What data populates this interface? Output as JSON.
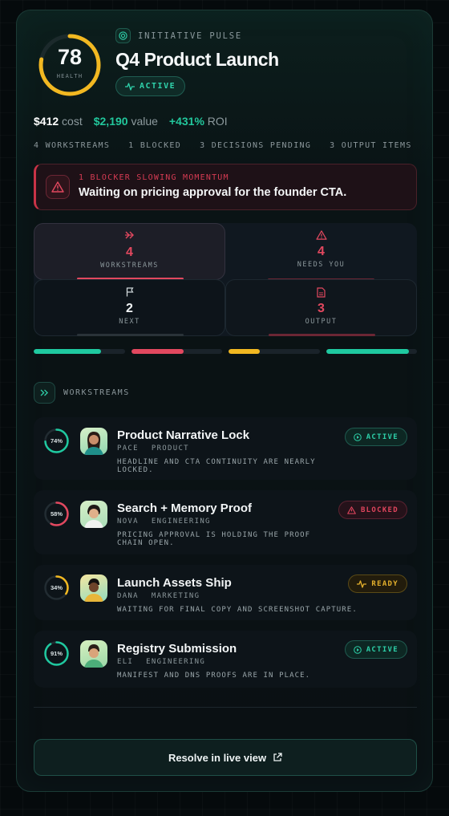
{
  "header": {
    "health_score": "78",
    "health_label": "HEALTH",
    "health_value": 0.78,
    "eyebrow": "INITIATIVE PULSE",
    "title": "Q4 Product Launch",
    "status": "ACTIVE"
  },
  "metrics": {
    "cost_value": "$412",
    "cost_label": "cost",
    "value_value": "$2,190",
    "value_label": "value",
    "roi_value": "+431%",
    "roi_label": "ROI"
  },
  "counts": [
    "4 WORKSTREAMS",
    "1 BLOCKED",
    "3 DECISIONS PENDING",
    "3 OUTPUT ITEMS"
  ],
  "alert": {
    "kicker": "1 BLOCKER SLOWING MOMENTUM",
    "message": "Waiting on pricing approval for the founder CTA."
  },
  "stats": [
    {
      "value": "4",
      "label": "WORKSTREAMS",
      "icon": "double-chevron-right-icon",
      "color": "#e2485f"
    },
    {
      "value": "4",
      "label": "NEEDS YOU",
      "icon": "warning-icon",
      "color": "#e2485f"
    },
    {
      "value": "2",
      "label": "NEXT",
      "icon": "flag-icon",
      "color": "#f2f5f6"
    },
    {
      "value": "3",
      "label": "OUTPUT",
      "icon": "document-icon",
      "color": "#e2485f"
    }
  ],
  "progress_segments": [
    {
      "fill": 0.74,
      "color": "#1fc9a0"
    },
    {
      "fill": 0.58,
      "color": "#e2485f"
    },
    {
      "fill": 0.34,
      "color": "#f2b821"
    },
    {
      "fill": 0.91,
      "color": "#1fc9a0"
    }
  ],
  "section_title": "WORKSTREAMS",
  "workstreams": [
    {
      "pct": "74%",
      "progress": 0.74,
      "ring_color": "#1fc9a0",
      "name": "Product Narrative Lock",
      "owner": "PACE",
      "team": "PRODUCT",
      "desc": "HEADLINE AND CTA CONTINUITY ARE NEARLY LOCKED.",
      "status": "ACTIVE",
      "status_icon": "play-circle-icon"
    },
    {
      "pct": "58%",
      "progress": 0.58,
      "ring_color": "#e2485f",
      "name": "Search + Memory Proof",
      "owner": "NOVA",
      "team": "ENGINEERING",
      "desc": "PRICING APPROVAL IS HOLDING THE PROOF CHAIN OPEN.",
      "status": "BLOCKED",
      "status_icon": "warning-icon"
    },
    {
      "pct": "34%",
      "progress": 0.34,
      "ring_color": "#f2b821",
      "name": "Launch Assets Ship",
      "owner": "DANA",
      "team": "MARKETING",
      "desc": "WAITING FOR FINAL COPY AND SCREENSHOT CAPTURE.",
      "status": "READY",
      "status_icon": "pulse-icon"
    },
    {
      "pct": "91%",
      "progress": 0.91,
      "ring_color": "#1fc9a0",
      "name": "Registry Submission",
      "owner": "ELI",
      "team": "ENGINEERING",
      "desc": "MANIFEST AND DNS PROOFS ARE IN PLACE.",
      "status": "ACTIVE",
      "status_icon": "play-circle-icon"
    }
  ],
  "cta": {
    "label": "Resolve in live view",
    "icon": "external-link-icon"
  }
}
